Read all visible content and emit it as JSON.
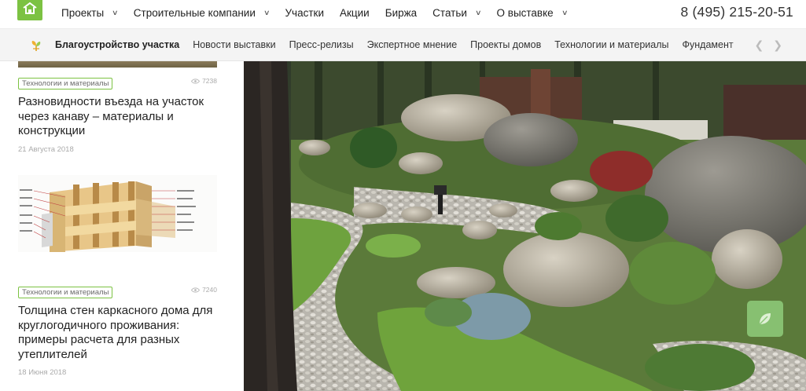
{
  "nav": {
    "items": [
      {
        "label": "Проекты",
        "dropdown": true
      },
      {
        "label": "Строительные компании",
        "dropdown": true
      },
      {
        "label": "Участки",
        "dropdown": false
      },
      {
        "label": "Акции",
        "dropdown": false
      },
      {
        "label": "Биржа",
        "dropdown": false
      },
      {
        "label": "Статьи",
        "dropdown": true
      },
      {
        "label": "О выставке",
        "dropdown": true
      }
    ],
    "phone": "8 (495) 215-20-51"
  },
  "subnav": {
    "items": [
      {
        "label": "Благоустройство участка",
        "active": true
      },
      {
        "label": "Новости выставки",
        "active": false
      },
      {
        "label": "Пресс-релизы",
        "active": false
      },
      {
        "label": "Экспертное мнение",
        "active": false
      },
      {
        "label": "Проекты домов",
        "active": false
      },
      {
        "label": "Технологии и материалы",
        "active": false
      },
      {
        "label": "Фундамент",
        "active": false
      }
    ]
  },
  "articles": [
    {
      "tag": "Технологии и материалы",
      "views": "7238",
      "title": "Разновидности въезда на участок через канаву – материалы и конструкции",
      "date": "21 Августа 2018"
    },
    {
      "tag": "Технологии и материалы",
      "views": "7240",
      "title": "Толщина стен каркасного дома для круглогодичного проживания: примеры расчета для разных утеплителей",
      "date": "18 Июня 2018"
    }
  ],
  "colors": {
    "accent": "#7cc242",
    "subbar_bg": "#f4f4f4"
  }
}
